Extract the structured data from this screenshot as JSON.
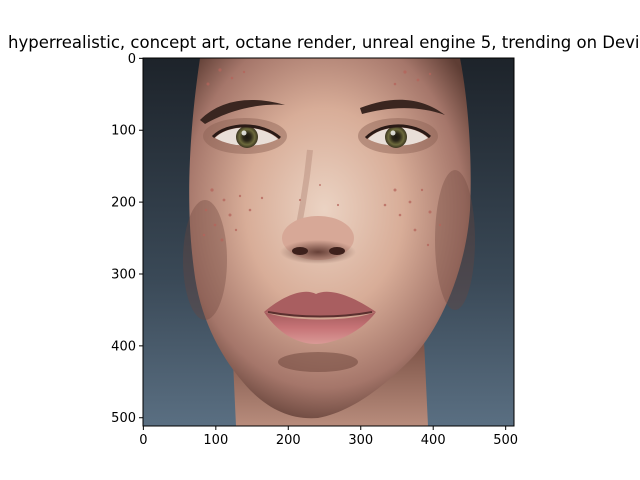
{
  "figure": {
    "title": "hyperrealistic, concept art, octane render, unreal engine 5, trending on Devi",
    "image": {
      "description": "close-up render of a bald human face with freckled skin, greenish-brown eyes, pink lips, on a dark blue-grey background",
      "extent": {
        "x": [
          0,
          512
        ],
        "y": [
          512,
          0
        ]
      }
    },
    "x_axis": {
      "ticks": [
        0,
        100,
        200,
        300,
        400,
        500
      ]
    },
    "y_axis": {
      "ticks": [
        0,
        100,
        200,
        300,
        400,
        500
      ]
    },
    "colors": {
      "background_top": "#1d232a",
      "background_bottom": "#52667a",
      "skin_light": "#e9cdbd",
      "skin_mid": "#c99a86",
      "skin_shadow": "#5e3d34",
      "lips": "#c77477",
      "iris": "#6d6a3c",
      "freckle": "#b5645b"
    }
  }
}
